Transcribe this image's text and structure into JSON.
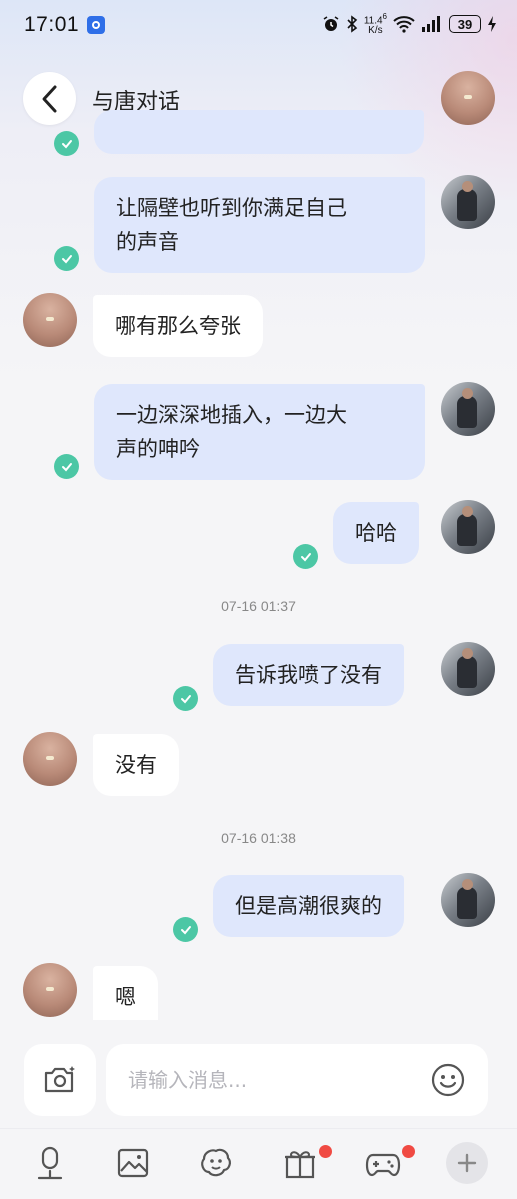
{
  "status_bar": {
    "time": "17:01",
    "net_speed_value": "11.4",
    "net_speed_unit": "K/s",
    "net_speed_sup": "6",
    "battery": "39"
  },
  "header": {
    "title": "与唐对话"
  },
  "messages": [
    {
      "sender": "me",
      "text": "让隔壁也听到你满足自己的声音",
      "line1": "让隔壁也听到你满足自己",
      "line2": "的声音",
      "read": true
    },
    {
      "sender": "them",
      "text": "哪有那么夸张"
    },
    {
      "sender": "me",
      "text": "一边深深地插入，一边大声的呻吟",
      "line1": "一边深深地插入，一边大",
      "line2": "声的呻吟",
      "read": true
    },
    {
      "sender": "me",
      "text": "哈哈",
      "read": true
    },
    {
      "sender": "me",
      "text": "告诉我喷了没有",
      "read": true
    },
    {
      "sender": "them",
      "text": "没有"
    },
    {
      "sender": "me",
      "text": "但是高潮很爽的",
      "read": true
    },
    {
      "sender": "them",
      "text": "嗯"
    }
  ],
  "timestamps": [
    "07-16 01:37",
    "07-16 01:38"
  ],
  "input": {
    "placeholder": "请输入消息..."
  },
  "bottom_bar": {
    "items": [
      "voice-icon",
      "image-icon",
      "sticker-icon",
      "gift-icon",
      "game-icon",
      "plus-icon"
    ],
    "badges": {
      "gift": true,
      "game": true
    }
  },
  "colors": {
    "my_bubble": "#dfe7fc",
    "their_bubble": "#ffffff",
    "read_check": "#4cc7a5",
    "badge": "#f04a43"
  }
}
